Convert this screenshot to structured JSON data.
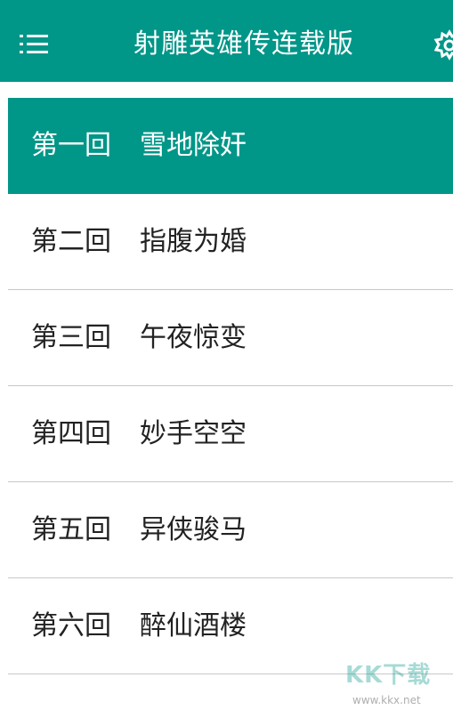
{
  "header": {
    "title": "射雕英雄传连载版",
    "menu_icon": "menu-icon",
    "settings_icon": "gear-icon"
  },
  "chapters": [
    {
      "num": "第一回",
      "name": "雪地除奸",
      "selected": true
    },
    {
      "num": "第二回",
      "name": "指腹为婚",
      "selected": false
    },
    {
      "num": "第三回",
      "name": "午夜惊变",
      "selected": false
    },
    {
      "num": "第四回",
      "name": "妙手空空",
      "selected": false
    },
    {
      "num": "第五回",
      "name": "异侠骏马",
      "selected": false
    },
    {
      "num": "第六回",
      "name": "醉仙酒楼",
      "selected": false
    }
  ],
  "watermark": {
    "logo": "KK下载",
    "url": "www.kkx.net"
  },
  "colors": {
    "accent": "#009688",
    "text": "#222222",
    "divider": "#c8c8c8"
  }
}
